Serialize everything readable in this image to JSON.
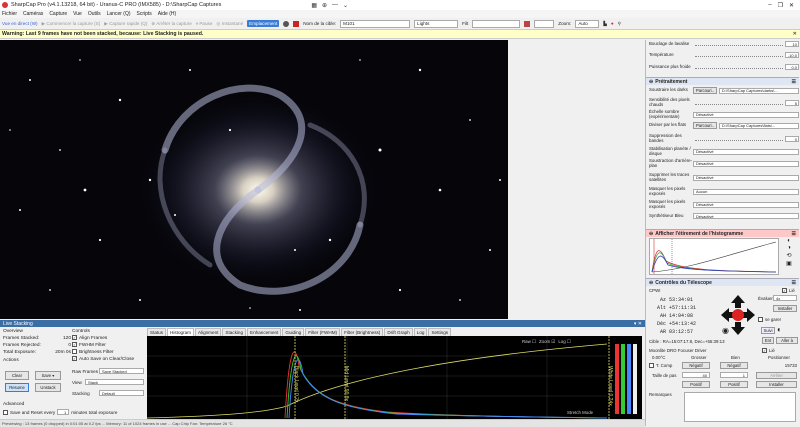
{
  "app_title": "SharpCap Pro (v4.1.13218, 64 bit) - Uranus-C PRO (IMX585) - D:\\SharpCap Captures",
  "menu": [
    "Fichier",
    "Caméras",
    "Capture",
    "Vue",
    "Outils",
    "Lancer (Q)",
    "Scripts",
    "Aide (H)"
  ],
  "toolbar": {
    "live": "Vue en direct (W)",
    "start": "Commencer la capture (S)",
    "quick": "Capture rapide (Q)",
    "stop": "Arrêter la capture",
    "pause": "Pause",
    "snapshot": "Instantané",
    "placement": "Emplacement",
    "target_label": "Nom de la cible:",
    "target_value": "M101",
    "frame_type": "Lights",
    "filter_label": "Filt",
    "zoom_label": "Zoom:",
    "zoom_value": "Auto"
  },
  "warning": "Warning: Last 9 frames have not been stacked, because: Live Stacking is paused.",
  "right": {
    "top_rows": [
      {
        "label": "Bouclage de lavalise",
        "value": "10"
      },
      {
        "label": "Température",
        "value": "-10.0"
      },
      {
        "label": "Puissance plus froide",
        "value": "0.0"
      }
    ],
    "pre_title": "Prétraitement",
    "pre_rows": [
      {
        "label": "Soustraire les darks",
        "btn": "Parcouri..",
        "value": "D:\\SharpCap Captures\\darks\\..."
      },
      {
        "label": "Sensibilité des pixels chauds",
        "value": "5"
      },
      {
        "label": "Échelle sombre (expérimentale)",
        "value": "Désactivé"
      },
      {
        "label": "Diviser par les flats",
        "btn": "Parcouri..",
        "value": "D:\\SharpCap Captures\\flats\\..."
      },
      {
        "label": "Suppression des bandes",
        "value": "0"
      },
      {
        "label": "Stabilisation planète / disque",
        "value": "Désactivé"
      },
      {
        "label": "Soustraction d'arrière-plan",
        "value": "Désactivé"
      },
      {
        "label": "Supprimer les traces satellites",
        "value": "Désactivé"
      },
      {
        "label": "Masquer les pixels exposés",
        "value": "Aucun"
      },
      {
        "label": "Masquer les pixels exposés",
        "value": "Désactivé"
      },
      {
        "label": "Synthétiseur Bleu",
        "value": "Désactivé"
      }
    ],
    "hist_title": "Afficher l'étirement de l'histogramme",
    "tel_title": "Contrôles du Télescope",
    "tel": {
      "cpwi": "CPWI",
      "lie": "Lié",
      "az_l": "Az",
      "az_v": "53:34:01",
      "alt_l": "Alt",
      "alt_v": "+57:11:31",
      "ah_l": "AH",
      "ah_v": "14:04:08",
      "dec_l": "Déc",
      "dec_v": "+54:13:42",
      "ar_l": "AR",
      "ar_v": "03:12:57",
      "evaluer": "Évaluer",
      "rate": "4x",
      "installer": "Installer",
      "se_garer": "se garer",
      "suivi": "Suivi",
      "cible": "Cible : RA=15:07:17.8, Dec=+55:39:13",
      "ent": "Ent",
      "aller": "Aller à"
    },
    "focus": {
      "title": "Moonlite DRO Focuser Driver",
      "temp": "0.00°C",
      "grosser": "Grosser",
      "bien": "Bien",
      "lie": "Lié",
      "positionner": "Positionner",
      "tcomp": "T. Comp",
      "negatif": "Négatif",
      "position": "15733",
      "step_l": "Taille de pas",
      "step1": "40",
      "step2": "1",
      "arreter": "Arrêter",
      "positif": "Positif",
      "installer": "Installer"
    },
    "remarques": "Remarques"
  },
  "live_stacking": {
    "header": "Live Stacking",
    "overview": "Overview",
    "stacked_l": "Frames Stacked:",
    "stacked_v": "120",
    "rejected_l": "Frames Rejected:",
    "rejected_v": "0",
    "exposure_l": "Total Exposure:",
    "exposure_v": "20m 0s",
    "actions": "Actions",
    "clear": "Clear",
    "save": "Save",
    "resume": "Resume",
    "unstack": "Unstack",
    "advanced": "Advanced",
    "save_reset": "Save and Reset every",
    "minutes": "minutes total exposure",
    "controls": "Controls",
    "align": "Align Frames",
    "fwhm": "FWHM Filter",
    "bright": "Brightness Filter",
    "autosave": "Auto Save on Clear/Close",
    "raw_l": "Raw Frames",
    "raw_v": "Save Stacked",
    "view_l": "View",
    "view_v": "Stack",
    "stacking_l": "Stacking",
    "stacking_v": "Default",
    "tabs": [
      "Status",
      "Histogram",
      "Alignment",
      "Stacking",
      "Enhancement",
      "Guiding",
      "Filter (FWHM)",
      "Filter (Brightness)",
      "Drift Graph",
      "Log",
      "Settings"
    ],
    "hist_controls": {
      "raw": "Raw",
      "zoom": "Zoom",
      "log": "Log",
      "stretch": "Stretch Mode"
    },
    "black_level": "Black Level 0.2x",
    "mid_level": "Mid Level 90.8x",
    "white_level": "White Level 0.24x"
  },
  "statusbar": "Previewing : 13 frames (0 dropped) in 0:01:05 at 0.2 fps ... Memory: 11 of 1024 frames in use ... Cap Chip Fan: Température 26 °C"
}
